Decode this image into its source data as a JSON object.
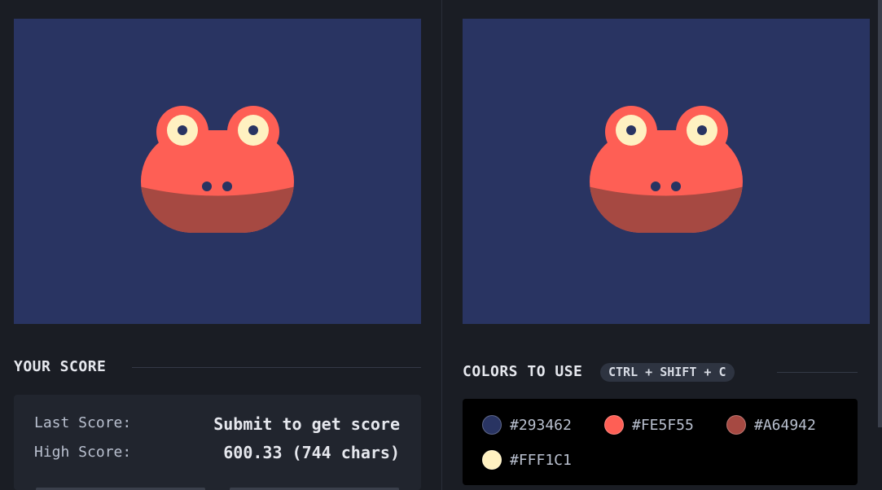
{
  "target_canvas": {
    "colors": {
      "background": "#293462",
      "primary": "#FE5F55",
      "secondary": "#A64942",
      "highlight": "#FFF1C1"
    }
  },
  "output_canvas": {
    "colors": {
      "background": "#293462",
      "primary": "#FE5F55",
      "secondary": "#A64942",
      "highlight": "#FFF1C1"
    }
  },
  "score": {
    "heading": "YOUR SCORE",
    "last_label": "Last Score:",
    "last_value": "Submit to get score",
    "high_label": "High Score:",
    "high_value": "600.33 (744 chars)"
  },
  "colors_section": {
    "heading": "COLORS TO USE",
    "shortcut": "CTRL + SHIFT + C",
    "swatches": [
      {
        "hex": "#293462",
        "color": "#293462"
      },
      {
        "hex": "#FE5F55",
        "color": "#FE5F55"
      },
      {
        "hex": "#A64942",
        "color": "#A64942"
      },
      {
        "hex": "#FFF1C1",
        "color": "#FFF1C1"
      }
    ]
  }
}
